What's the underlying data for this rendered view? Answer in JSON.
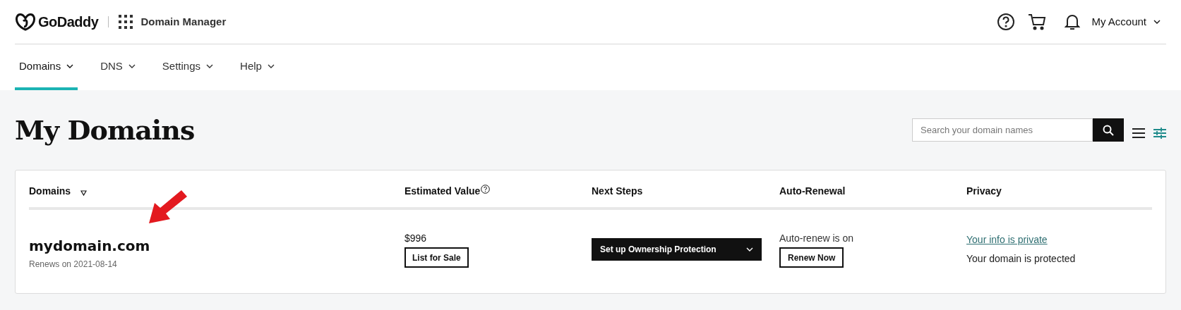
{
  "header": {
    "brand": "GoDaddy",
    "app_title": "Domain Manager",
    "account": "My Account"
  },
  "nav": [
    {
      "label": "Domains",
      "selected": true
    },
    {
      "label": "DNS",
      "selected": false
    },
    {
      "label": "Settings",
      "selected": false
    },
    {
      "label": "Help",
      "selected": false
    }
  ],
  "page_title": "My Domains",
  "search": {
    "placeholder": "Search your domain names"
  },
  "table": {
    "columns": [
      "Domains",
      "Estimated Value",
      "Next Steps",
      "Auto-Renewal",
      "Privacy"
    ],
    "rows": [
      {
        "domain": "mydomain.com",
        "renews": "Renews on 2021-08-14",
        "value": "$996",
        "list_button": "List for Sale",
        "next_step": "Set up Ownership Protection",
        "auto_renew": "Auto-renew is on",
        "renew_button": "Renew Now",
        "privacy_link": "Your info is private",
        "privacy_status": "Your domain is protected"
      }
    ]
  }
}
